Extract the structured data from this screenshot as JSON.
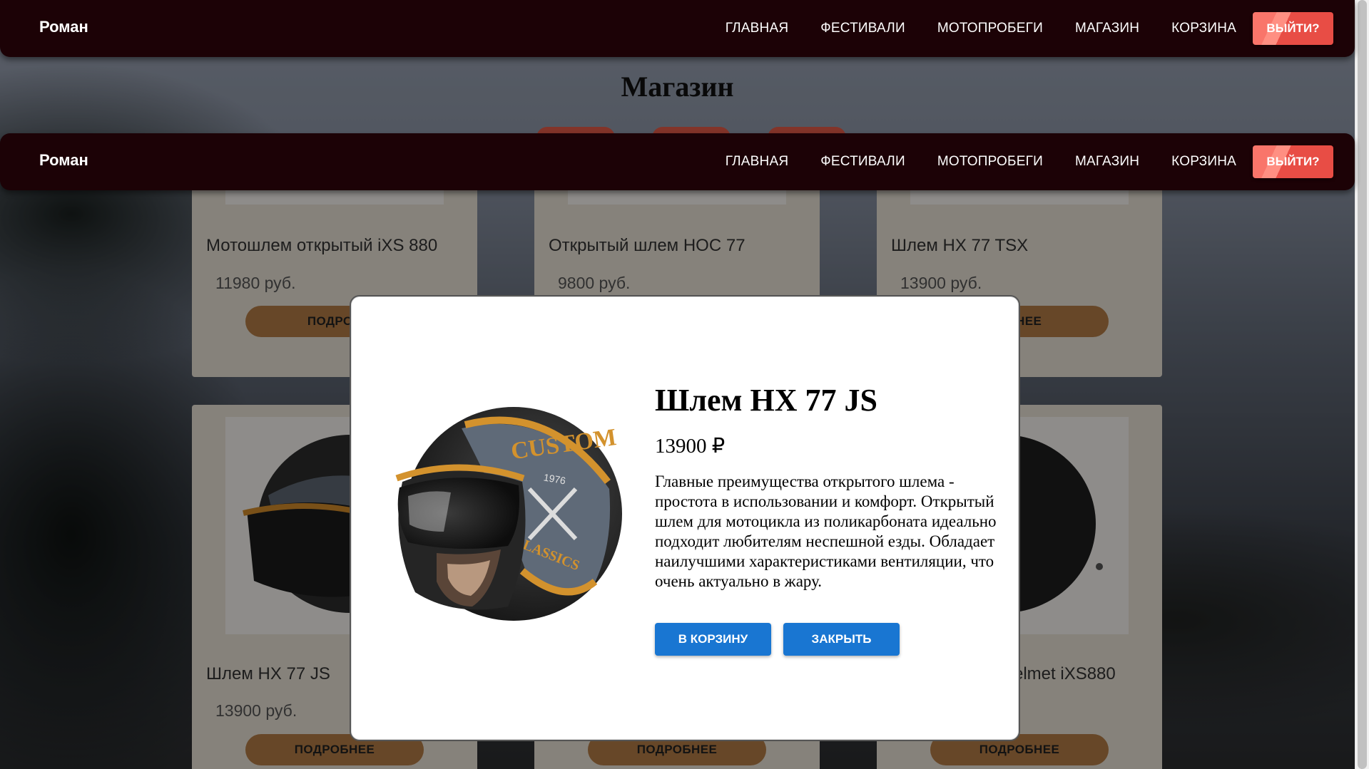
{
  "nav": {
    "brand": "Роман",
    "items": [
      "ГЛАВНАЯ",
      "ФЕСТИВАЛИ",
      "МОТОПРОБЕГИ",
      "МАГАЗИН",
      "КОРЗИНА"
    ],
    "logout": "ВЫЙТИ?"
  },
  "page": {
    "title": "Магазин"
  },
  "products": [
    {
      "name": "Мотошлем открытый iXS 880",
      "price": "11980 руб.",
      "button": "ПОДРОБ"
    },
    {
      "name": "Открытый шлем HOC 77",
      "price": "9800 руб.",
      "button": ""
    },
    {
      "name": "Шлем HX 77 TSX",
      "price": "13900 руб.",
      "button": "ОБНЕЕ"
    },
    {
      "name": "Шлем HX 77 JS",
      "price": "13900 руб.",
      "button": "ПОДРОБНЕЕ"
    },
    {
      "name": "",
      "price": "",
      "button": "ПОДРОБНЕЕ"
    },
    {
      "name": "elmet iXS880",
      "price": "",
      "button": "ПОДРОБНЕЕ"
    }
  ],
  "modal": {
    "title": "Шлем HX 77 JS",
    "price": "13900 ₽",
    "description": "Главные преимущества открытого шлема - простота в использовании и комфорт. Открытый шлем для мотоцикла из поликарбоната идеально подходит любителям неспешной езды. Обладает наилучшими характеристиками вентиляции, что очень актуально в жару.",
    "add_to_cart": "В КОРЗИНУ",
    "close": "ЗАКРЫТЬ",
    "helmet_text_1": "CUSTOM",
    "helmet_text_2": "1976",
    "helmet_text_3": "CLASSICS"
  },
  "colors": {
    "navbar": "#1c0206",
    "logout": "#f9756a",
    "primary_button": "#1976d2",
    "card_button": "#b27b45"
  }
}
